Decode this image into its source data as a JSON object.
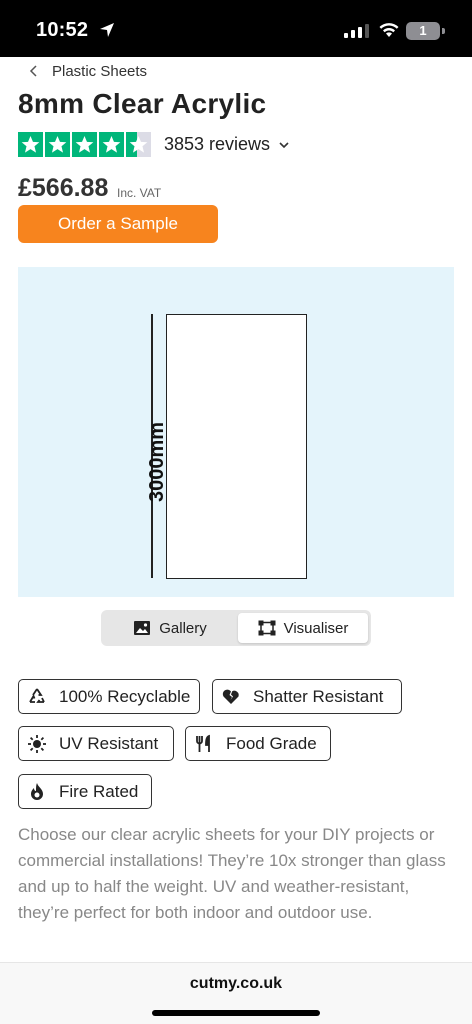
{
  "status_bar": {
    "time": "10:52",
    "battery": "1"
  },
  "breadcrumb": {
    "label": "Plastic Sheets"
  },
  "product": {
    "title": "8mm Clear Acrylic",
    "rating": 4.5,
    "reviews": "3853 reviews",
    "price": "£566.88",
    "vat": "Inc. VAT",
    "sample_button": "Order a Sample"
  },
  "visualiser": {
    "dimension_label": "3000mm"
  },
  "view_toggle": {
    "gallery": "Gallery",
    "visualiser": "Visualiser",
    "selected": "Visualiser"
  },
  "features": [
    {
      "label": "100% Recyclable",
      "icon": "recycle-icon"
    },
    {
      "label": "Shatter Resistant",
      "icon": "broken-heart-icon"
    },
    {
      "label": "UV Resistant",
      "icon": "sun-icon"
    },
    {
      "label": "Food Grade",
      "icon": "cutlery-icon"
    },
    {
      "label": "Fire Rated",
      "icon": "flame-icon"
    }
  ],
  "description": "Choose our clear acrylic sheets for your DIY projects or commercial installations! They’re 10x stronger than glass and up to half the weight. UV and weather-resistant, they’re perfect for both indoor and outdoor use.",
  "browser": {
    "url": "cutmy.co.uk"
  },
  "colors": {
    "accent": "#f7841e",
    "trustpilot_green": "#00b67a",
    "visual_bg": "#e4f4fb"
  }
}
